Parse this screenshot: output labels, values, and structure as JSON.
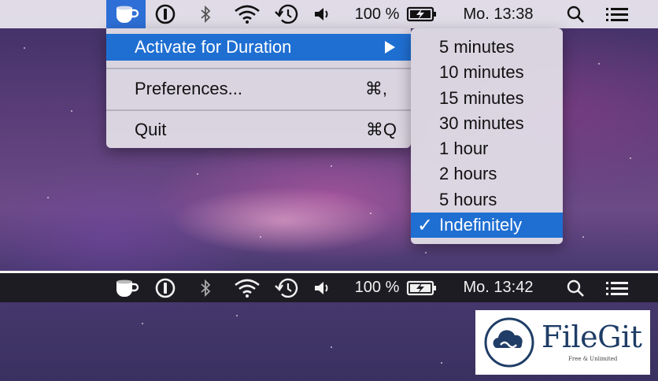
{
  "top_menubar": {
    "battery_percent": "100 %",
    "clock": "Mo. 13:38"
  },
  "bottom_menubar": {
    "battery_percent": "100 %",
    "clock": "Mo. 13:42"
  },
  "app_menu": {
    "items": [
      {
        "label": "Activate for Duration",
        "shortcut": ""
      },
      {
        "label": "Preferences...",
        "shortcut": "⌘,"
      },
      {
        "label": "Quit",
        "shortcut": "⌘Q"
      }
    ]
  },
  "duration_submenu": {
    "items": [
      {
        "label": "5 minutes",
        "checked": false
      },
      {
        "label": "10 minutes",
        "checked": false
      },
      {
        "label": "15 minutes",
        "checked": false
      },
      {
        "label": "30 minutes",
        "checked": false
      },
      {
        "label": "1 hour",
        "checked": false
      },
      {
        "label": "2 hours",
        "checked": false
      },
      {
        "label": "5 hours",
        "checked": false
      },
      {
        "label": "Indefinitely",
        "checked": true
      }
    ],
    "check_glyph": "✓"
  },
  "watermark": {
    "name": "FileGit",
    "tagline": "Free & Unlimited"
  },
  "colors": {
    "highlight": "#1f6fd2",
    "watermark_text": "#1f3d66"
  },
  "icons": [
    "coffee-cup-icon",
    "info-icon",
    "bluetooth-icon",
    "wifi-icon",
    "time-machine-icon",
    "volume-icon",
    "battery-charging-icon",
    "search-icon",
    "list-icon"
  ]
}
